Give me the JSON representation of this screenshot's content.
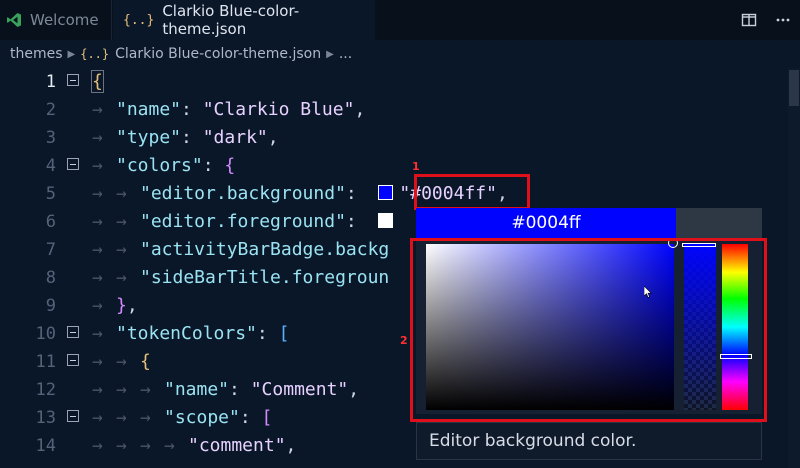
{
  "tabs": [
    {
      "label": "Welcome",
      "icon": "vscode-logo-icon",
      "active": false
    },
    {
      "label": "Clarkio Blue-color-theme.json",
      "icon": "json-braces-icon",
      "active": true
    }
  ],
  "json_icon_glyph": "{..}",
  "breadcrumb": {
    "folder": "themes",
    "file": "Clarkio Blue-color-theme.json",
    "more": "..."
  },
  "gutter": [
    "1",
    "2",
    "3",
    "4",
    "5",
    "6",
    "7",
    "8",
    "9",
    "10",
    "11",
    "12",
    "13",
    "14"
  ],
  "code": {
    "l1": "{",
    "l2": {
      "key": "\"name\"",
      "sep": ": ",
      "val": "\"Clarkio Blue\"",
      "tail": ","
    },
    "l3": {
      "key": "\"type\"",
      "sep": ": ",
      "val": "\"dark\"",
      "tail": ","
    },
    "l4": {
      "key": "\"colors\"",
      "sep": ": ",
      "open": "{"
    },
    "l5": {
      "key": "\"editor.background\"",
      "sep": ":  ",
      "val": "\"#0004ff\"",
      "tail": ","
    },
    "l6": {
      "key": "\"editor.foreground\"",
      "sep": ":  "
    },
    "l7": {
      "key": "\"activityBarBadge.backg"
    },
    "l8": {
      "key": "\"sideBarTitle.foregroun"
    },
    "l9": {
      "close": "}",
      "tail": ","
    },
    "l10": {
      "key": "\"tokenColors\"",
      "sep": ": ",
      "open": "["
    },
    "l11": {
      "open": "{"
    },
    "l12": {
      "key": "\"name\"",
      "sep": ": ",
      "val": "\"Comment\"",
      "tail": ","
    },
    "l13": {
      "key": "\"scope\"",
      "sep": ": ",
      "open": "["
    },
    "l14": {
      "val": "\"comment\"",
      "tail": ","
    }
  },
  "annotations": {
    "one": "1",
    "two": "2"
  },
  "color_picker": {
    "current_value": "#0004ff",
    "description": "Editor background color.",
    "hue_level": 0.67,
    "opacity_level": 1.0
  },
  "colors": {
    "background": "#0004ff",
    "foreground": "#ffffff",
    "annotation": "#e0101a"
  }
}
